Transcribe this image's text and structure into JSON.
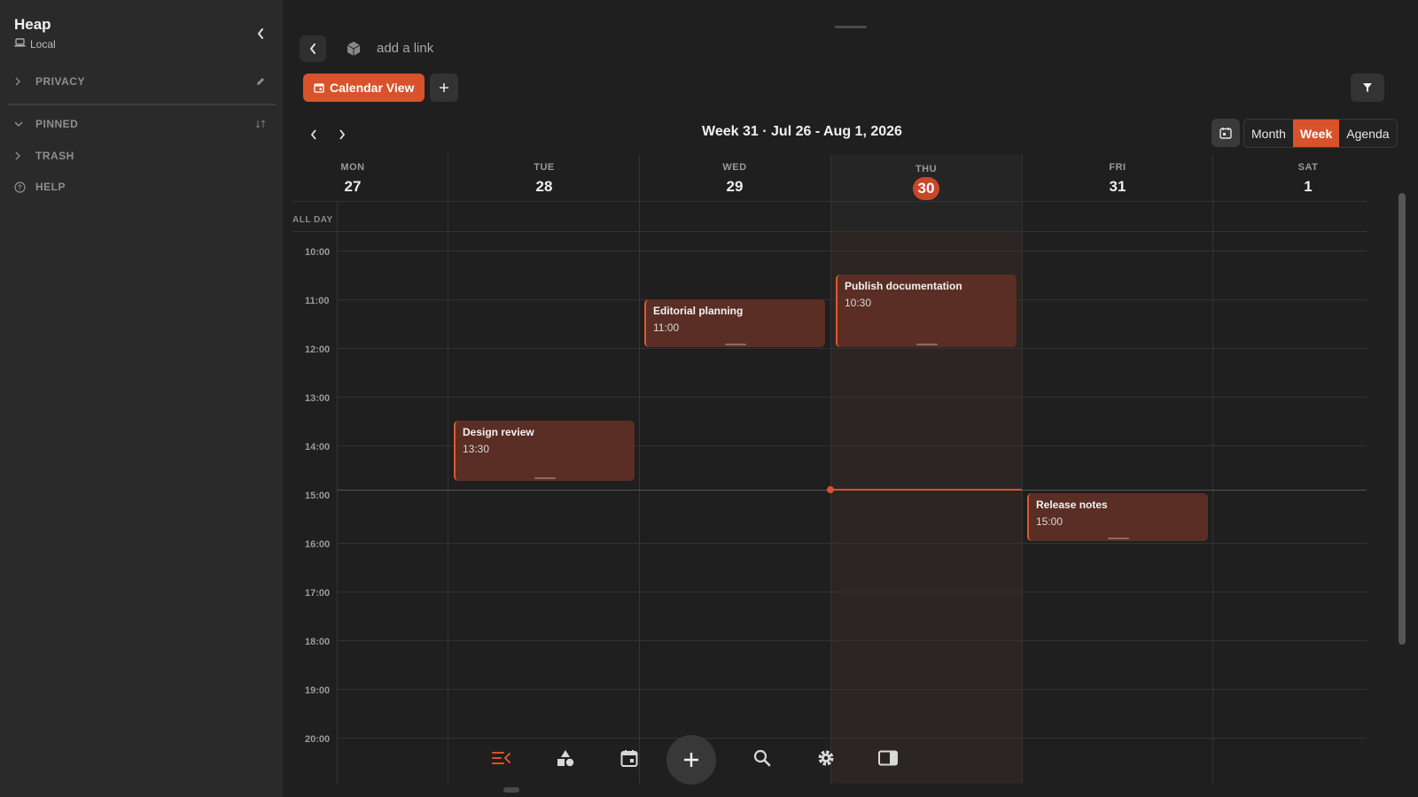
{
  "sidebar": {
    "title": "Heap",
    "subtitle": "Local",
    "sections": [
      {
        "label": "PRIVACY"
      },
      {
        "label": "PINNED"
      },
      {
        "label": "TRASH"
      },
      {
        "label": "HELP"
      }
    ]
  },
  "header": {
    "link_placeholder": "add a link",
    "view_label": "Calendar View"
  },
  "calendar": {
    "week_title": "Week 31 · Jul 26 - Aug 1, 2026",
    "modes": [
      "Month",
      "Week",
      "Agenda"
    ],
    "active_mode": "Week",
    "all_day_label": "ALL DAY",
    "days": [
      {
        "name": "MON",
        "num": "27"
      },
      {
        "name": "TUE",
        "num": "28"
      },
      {
        "name": "WED",
        "num": "29"
      },
      {
        "name": "THU",
        "num": "30",
        "today": true
      },
      {
        "name": "FRI",
        "num": "31"
      },
      {
        "name": "SAT",
        "num": "1"
      }
    ],
    "hours": [
      "10:00",
      "11:00",
      "12:00",
      "13:00",
      "14:00",
      "15:00",
      "16:00",
      "17:00",
      "18:00",
      "19:00",
      "20:00"
    ],
    "events": [
      {
        "title": "Editorial planning",
        "time": "11:00",
        "day": "WED"
      },
      {
        "title": "Publish documentation",
        "time": "10:30",
        "day": "THU"
      },
      {
        "title": "Design review",
        "time": "13:30",
        "day": "TUE"
      },
      {
        "title": "Release notes",
        "time": "15:00",
        "day": "FRI"
      }
    ],
    "accent": "#d8532b",
    "event_bg": "#5a2e24"
  },
  "toolbar": {
    "icons": [
      "list-icon",
      "shapes-icon",
      "calendar-icon",
      "add-icon",
      "search-icon",
      "gear-icon",
      "panel-icon"
    ]
  }
}
